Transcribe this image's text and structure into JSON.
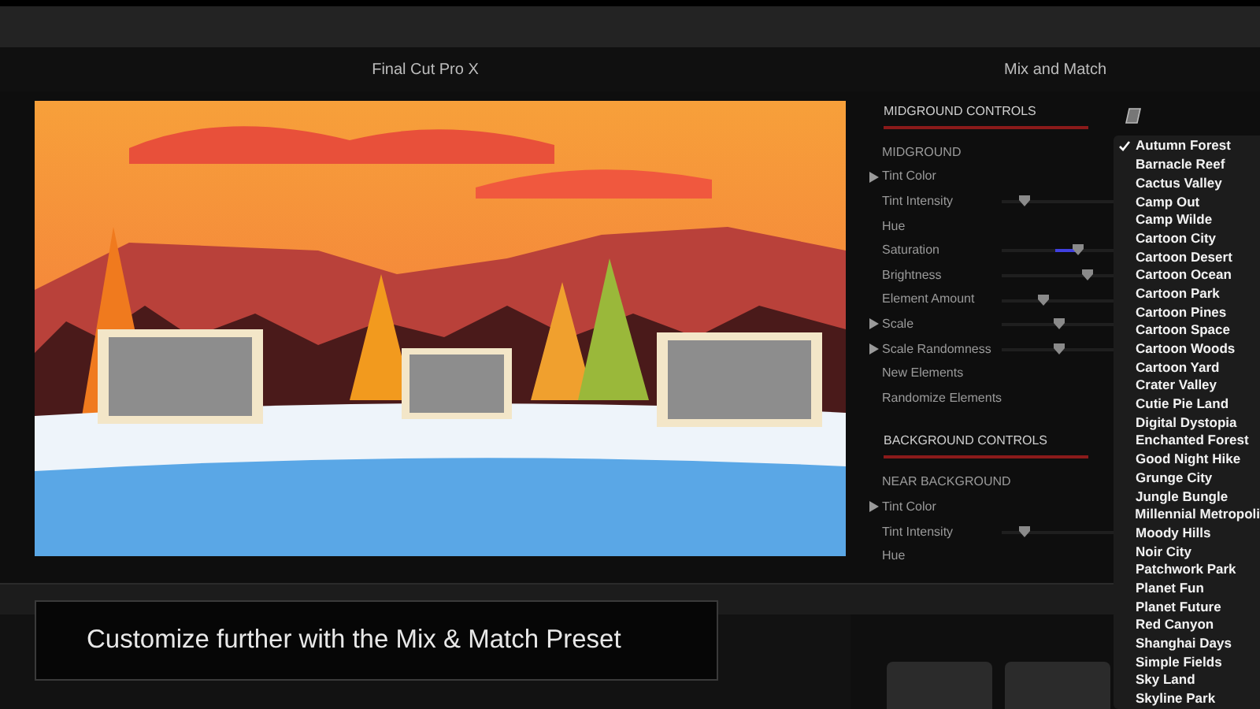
{
  "viewer": {
    "title": "Final Cut Pro X"
  },
  "panel": {
    "title": "Mix and Match",
    "sections": [
      {
        "title": "MIDGROUND CONTROLS",
        "rows": [
          {
            "label": "MIDGROUND",
            "kind": "group",
            "expandable": false
          },
          {
            "label": "Tint Color",
            "kind": "plain",
            "expandable": true
          },
          {
            "label": "Tint Intensity",
            "kind": "slider",
            "expandable": false,
            "level": 0.21,
            "highlighted": false
          },
          {
            "label": "Hue",
            "kind": "plain",
            "expandable": false
          },
          {
            "label": "Saturation",
            "kind": "slider",
            "expandable": false,
            "level": 0.69,
            "highlighted": true
          },
          {
            "label": "Brightness",
            "kind": "slider",
            "expandable": false,
            "level": 0.77,
            "highlighted": false
          },
          {
            "label": "Element Amount",
            "kind": "slider",
            "expandable": false,
            "level": 0.38,
            "highlighted": false
          },
          {
            "label": "Scale",
            "kind": "slider",
            "expandable": true,
            "level": 0.51,
            "highlighted": false
          },
          {
            "label": "Scale Randomness",
            "kind": "slider",
            "expandable": true,
            "level": 0.51,
            "highlighted": false
          },
          {
            "label": "New Elements",
            "kind": "plain",
            "expandable": false
          },
          {
            "label": "Randomize Elements",
            "kind": "plain",
            "expandable": false
          }
        ]
      },
      {
        "title": "BACKGROUND CONTROLS",
        "rows": [
          {
            "label": "NEAR BACKGROUND",
            "kind": "group",
            "expandable": false
          },
          {
            "label": "Tint Color",
            "kind": "plain",
            "expandable": true
          },
          {
            "label": "Tint Intensity",
            "kind": "slider",
            "expandable": false,
            "level": 0.21,
            "highlighted": false
          },
          {
            "label": "Hue",
            "kind": "plain",
            "expandable": false
          }
        ]
      }
    ]
  },
  "preset_menu": {
    "items": [
      {
        "label": "Autumn Forest",
        "selected": true
      },
      {
        "label": "Barnacle Reef",
        "selected": false
      },
      {
        "label": "Cactus Valley",
        "selected": false
      },
      {
        "label": "Camp Out",
        "selected": false
      },
      {
        "label": "Camp Wilde",
        "selected": false
      },
      {
        "label": "Cartoon City",
        "selected": false
      },
      {
        "label": "Cartoon Desert",
        "selected": false
      },
      {
        "label": "Cartoon Ocean",
        "selected": false
      },
      {
        "label": "Cartoon Park",
        "selected": false
      },
      {
        "label": "Cartoon Pines",
        "selected": false
      },
      {
        "label": "Cartoon Space",
        "selected": false
      },
      {
        "label": "Cartoon Woods",
        "selected": false
      },
      {
        "label": "Cartoon Yard",
        "selected": false
      },
      {
        "label": "Crater Valley",
        "selected": false
      },
      {
        "label": "Cutie Pie Land",
        "selected": false
      },
      {
        "label": "Digital Dystopia",
        "selected": false
      },
      {
        "label": "Enchanted Forest",
        "selected": false
      },
      {
        "label": "Good Night Hike",
        "selected": false
      },
      {
        "label": "Grunge City",
        "selected": false
      },
      {
        "label": "Jungle Bungle",
        "selected": false
      },
      {
        "label": "Millennial Metropoli",
        "selected": false
      },
      {
        "label": "Moody Hills",
        "selected": false
      },
      {
        "label": "Noir City",
        "selected": false
      },
      {
        "label": "Patchwork Park",
        "selected": false
      },
      {
        "label": "Planet Fun",
        "selected": false
      },
      {
        "label": "Planet Future",
        "selected": false
      },
      {
        "label": "Red Canyon",
        "selected": false
      },
      {
        "label": "Shanghai Days",
        "selected": false
      },
      {
        "label": "Simple Fields",
        "selected": false
      },
      {
        "label": "Sky Land",
        "selected": false
      },
      {
        "label": "Skyline Park",
        "selected": false
      }
    ]
  },
  "caption": "Customize further with the Mix & Match Preset"
}
